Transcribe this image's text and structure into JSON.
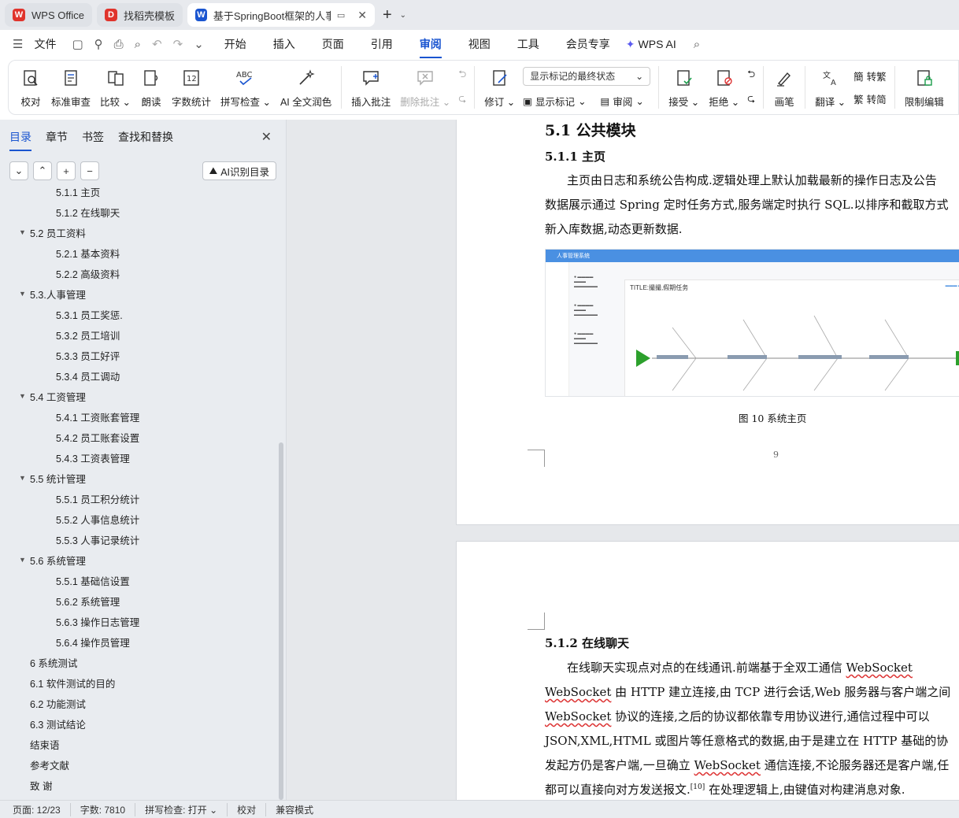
{
  "tabs": [
    {
      "label": "WPS Office",
      "logo": "W",
      "color": "#e0342c"
    },
    {
      "label": "找稻壳模板",
      "logo": "D",
      "color": "#e0342c"
    },
    {
      "label": "基于SpringBoot框架的人事管",
      "logo": "W",
      "color": "#1a55d0"
    }
  ],
  "menu": {
    "file": "文件",
    "items": [
      "开始",
      "插入",
      "页面",
      "引用",
      "审阅",
      "视图",
      "工具",
      "会员专享"
    ],
    "active": "审阅",
    "wps_ai": "WPS AI"
  },
  "ribbon": {
    "proofread": "校对",
    "standard_review": "标准审查",
    "compare": "比较",
    "read_aloud": "朗读",
    "word_count": "字数统计",
    "spell_check": "拼写检查",
    "ai_polish": "AI 全文润色",
    "insert_comment": "插入批注",
    "delete_comment": "删除批注",
    "revise": "修订",
    "markup_dropdown": "显示标记的最终状态",
    "show_markup": "显示标记",
    "review": "审阅",
    "accept": "接受",
    "reject": "拒绝",
    "pen": "画笔",
    "translate": "翻译",
    "to_traditional": "转繁",
    "to_simplified": "转简",
    "restrict_edit": "限制编辑"
  },
  "leftpane": {
    "tabs": [
      "目录",
      "章节",
      "书签",
      "查找和替换"
    ],
    "ai_toc": "AI识别目录",
    "toc": [
      {
        "label": "5.1.1 主页",
        "level": 3
      },
      {
        "label": "5.1.2 在线聊天",
        "level": 3
      },
      {
        "label": "5.2  员工资料",
        "level": 2,
        "expanded": true
      },
      {
        "label": "5.2.1 基本资料",
        "level": 3
      },
      {
        "label": "5.2.2  高级资料",
        "level": 3
      },
      {
        "label": "5.3.人事管理",
        "level": 2,
        "expanded": true
      },
      {
        "label": "5.3.1 员工奖惩.",
        "level": 3
      },
      {
        "label": "5.3.2 员工培训",
        "level": 3
      },
      {
        "label": "5.3.3 员工好评",
        "level": 3
      },
      {
        "label": "5.3.4 员工调动",
        "level": 3
      },
      {
        "label": "5.4 工资管理",
        "level": 2,
        "expanded": true
      },
      {
        "label": "5.4.1 工资账套管理",
        "level": 3
      },
      {
        "label": "5.4.2 员工账套设置",
        "level": 3
      },
      {
        "label": "5.4.3 工资表管理",
        "level": 3
      },
      {
        "label": "5.5 统计管理",
        "level": 2,
        "expanded": true
      },
      {
        "label": "5.5.1 员工积分统计",
        "level": 3
      },
      {
        "label": "5.5.2 人事信息统计",
        "level": 3
      },
      {
        "label": "5.5.3 人事记录统计",
        "level": 3
      },
      {
        "label": "5.6 系统管理",
        "level": 2,
        "expanded": true
      },
      {
        "label": "5.5.1 基础信设置",
        "level": 3
      },
      {
        "label": "5.6.2 系统管理",
        "level": 3
      },
      {
        "label": "5.6.3 操作日志管理",
        "level": 3
      },
      {
        "label": "5.6.4 操作员管理",
        "level": 3
      },
      {
        "label": "6 系统测试",
        "level": 1
      },
      {
        "label": "6.1  软件测试的目的",
        "level": 1
      },
      {
        "label": "6.2  功能测试",
        "level": 1
      },
      {
        "label": "6.3  测试结论",
        "level": 1
      },
      {
        "label": "结束语",
        "level": 1
      },
      {
        "label": "参考文献",
        "level": 1
      },
      {
        "label": "致    谢",
        "level": 1
      }
    ]
  },
  "document": {
    "page1": {
      "heading": "5.1  公共模块",
      "subheading": "5.1.1 主页",
      "lines": [
        "主页由日志和系统公告构成.逻辑处理上默认加载最新的操作日志及公告",
        "数据展示通过 Spring 定时任务方式,服务端定时执行 SQL.以排序和截取方式",
        "新入库数据,动态更新数据."
      ],
      "figure_title": "人事管理系统",
      "figure_inner_title": "TITLE:撮撮,假期任务",
      "caption": "图 10  系统主页",
      "page_number": "9"
    },
    "page2": {
      "subheading": "5.1.2 在线聊天",
      "lines": [
        "在线聊天实现点对点的在线通讯.前端基于全双工通信 WebSocket",
        "WebSocket 由 HTTP 建立连接,由 TCP 进行会话,Web 服务器与客户端之间",
        "WebSocket 协议的连接,之后的协议都依靠专用协议进行,通信过程中可以",
        "JSON,XML,HTML 或图片等任意格式的数据,由于是建立在 HTTP 基础的协",
        "发起方仍是客户端,一旦确立 WebSocket 通信连接,不论服务器还是客户端,任",
        "都可以直接向对方发送报文."
      ],
      "citation": "[10]",
      "last_line_tail": " 在处理逻辑上,由键值对构建消息对象."
    }
  },
  "status": {
    "page": "页面: 12/23",
    "words": "字数: 7810",
    "spell": "拼写检查: 打开",
    "proof": "校对",
    "compat": "兼容模式"
  },
  "colors": {
    "accent": "#1a55d0",
    "wps_red": "#e0342c"
  }
}
